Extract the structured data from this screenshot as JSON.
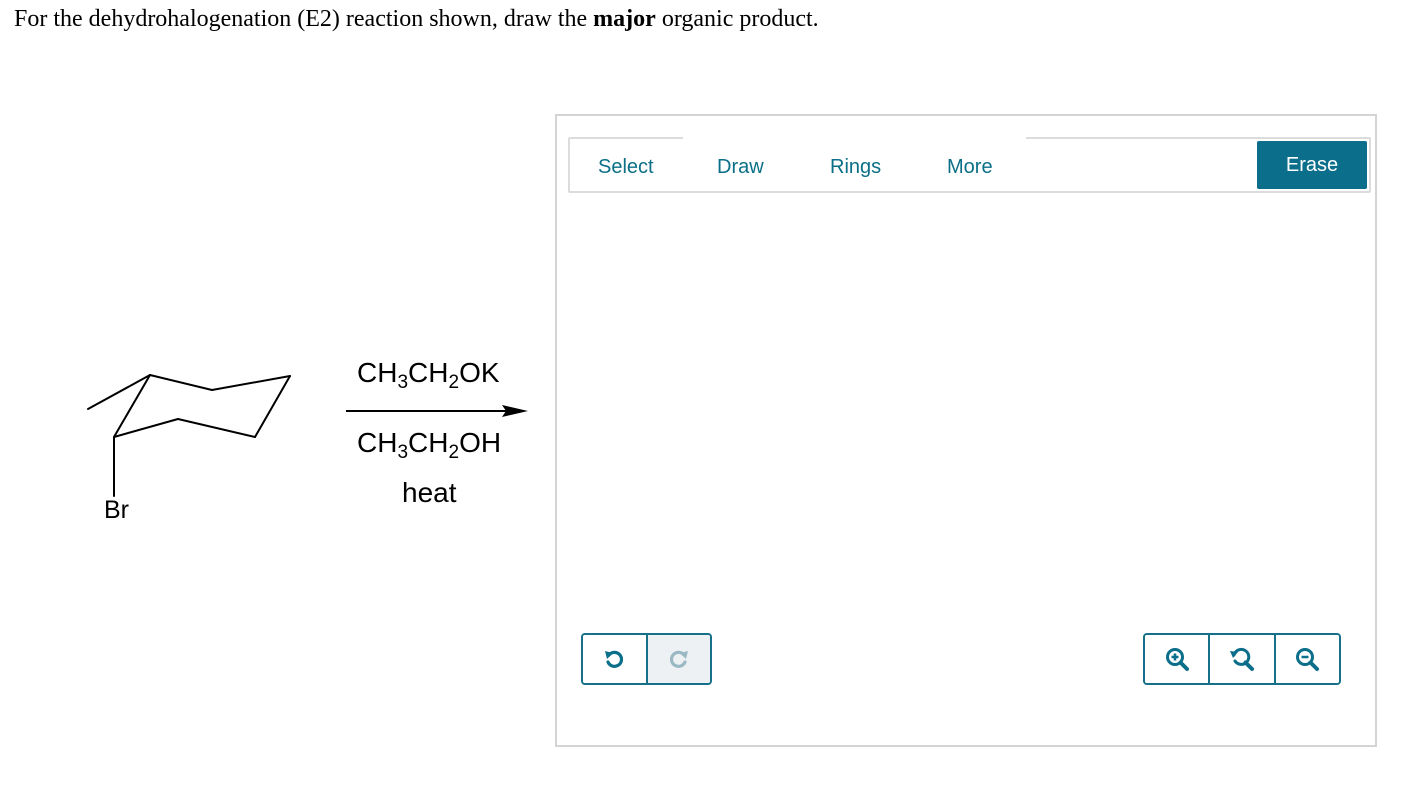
{
  "question": {
    "prefix": "For the dehydrohalogenation (E2) reaction shown, draw the ",
    "emphasis": "major",
    "suffix": " organic product."
  },
  "reaction": {
    "reagent_above": {
      "a": "CH",
      "b": "3",
      "c": "CH",
      "d": "2",
      "e": "OK"
    },
    "reagent_below": {
      "a": "CH",
      "b": "3",
      "c": "CH",
      "d": "2",
      "e": "OH"
    },
    "condition": "heat",
    "substituent": "Br"
  },
  "toolbar": {
    "tabs": [
      "Select",
      "Draw",
      "Rings",
      "More"
    ],
    "erase_label": "Erase"
  },
  "icons": {
    "undo": "undo-icon",
    "redo": "redo-icon",
    "zoom_in": "zoom-in-icon",
    "zoom_reset": "zoom-reset-icon",
    "zoom_out": "zoom-out-icon"
  },
  "colors": {
    "accent": "#0b6e8a",
    "redo_disabled": "#9bb9c4"
  }
}
